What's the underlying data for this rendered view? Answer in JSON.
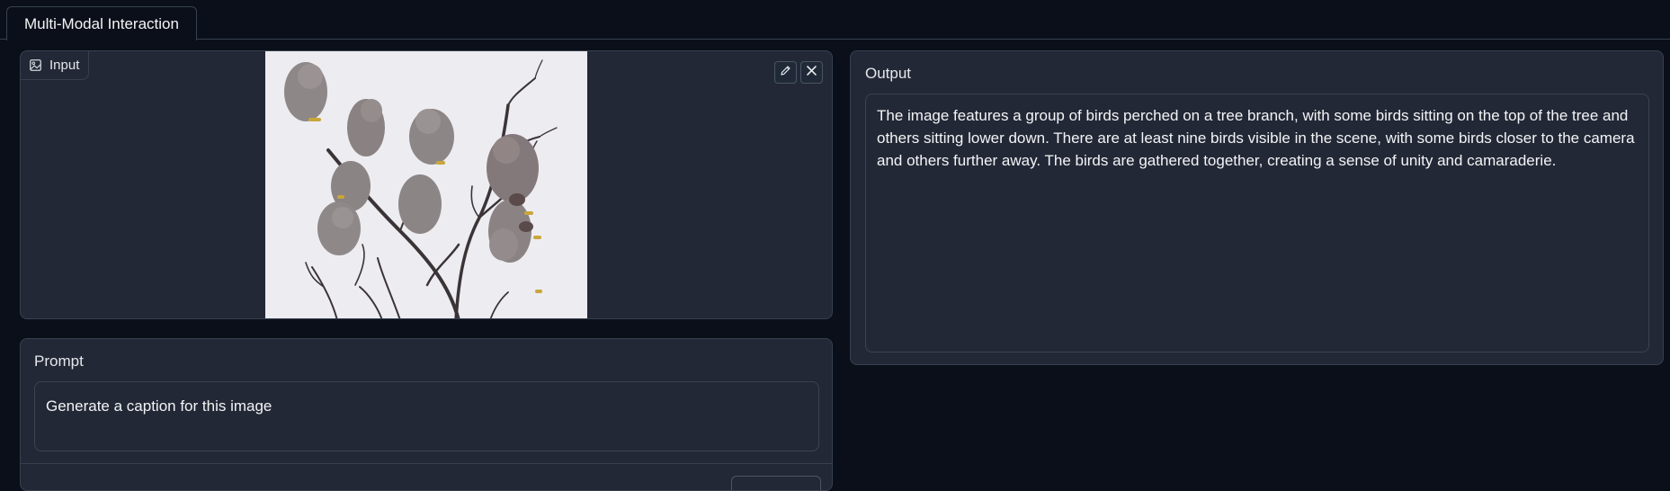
{
  "tabs": [
    {
      "label": "Multi-Modal Interaction",
      "active": true
    }
  ],
  "input": {
    "label": "Input",
    "label_icon": "image-icon",
    "image_description": "",
    "edit_icon": "pencil-icon",
    "close_icon": "close-icon"
  },
  "prompt": {
    "label": "Prompt",
    "value": "Generate a caption for this image"
  },
  "output": {
    "label": "Output",
    "value": "The image features a group of birds perched on a tree branch, with some birds sitting on the top of the tree and others sitting lower down. There are at least nine birds visible in the scene, with some birds closer to the camera and others further away. The birds are gathered together, creating a sense of unity and camaraderie."
  },
  "colors": {
    "background": "#0b0f19",
    "panel": "#232836",
    "border": "#374151",
    "text": "#e5e7eb"
  }
}
